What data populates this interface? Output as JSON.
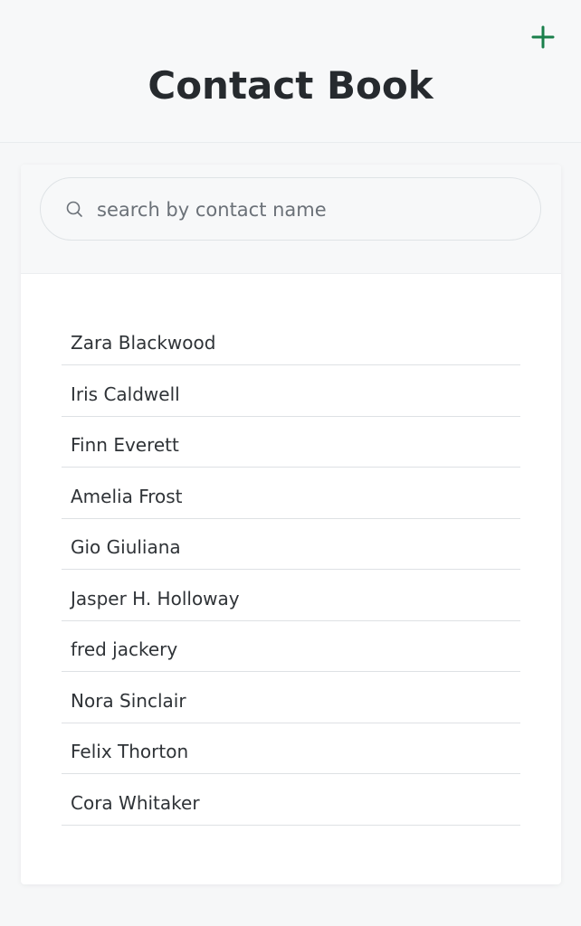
{
  "header": {
    "title": "Contact Book",
    "add_icon": "plus-icon",
    "accent_color": "#1a7f4b"
  },
  "search": {
    "placeholder": "search by contact name",
    "value": "",
    "icon": "search-icon"
  },
  "contacts": [
    {
      "name": "Zara Blackwood"
    },
    {
      "name": "Iris Caldwell"
    },
    {
      "name": "Finn Everett"
    },
    {
      "name": "Amelia Frost"
    },
    {
      "name": "Gio Giuliana"
    },
    {
      "name": "Jasper H. Holloway"
    },
    {
      "name": "fred jackery"
    },
    {
      "name": "Nora Sinclair"
    },
    {
      "name": "Felix Thorton"
    },
    {
      "name": "Cora Whitaker"
    }
  ]
}
